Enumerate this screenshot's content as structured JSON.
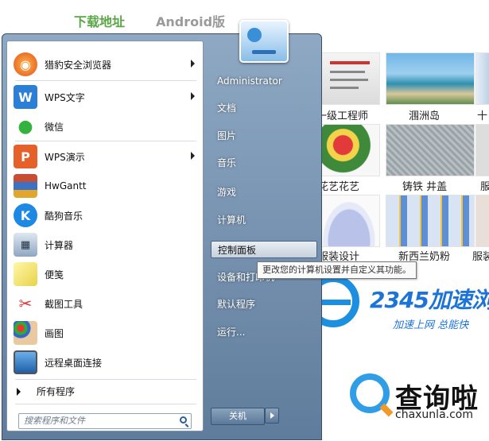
{
  "background": {
    "tabs": [
      "下载地址",
      "Android版"
    ],
    "captions": [
      "一级工程师",
      "涠洲岛",
      "十",
      "花艺花艺",
      "铸铁 井盖",
      "服",
      "服装设计",
      "新西兰奶粉",
      "服装"
    ],
    "brand": {
      "name": "2345加速浏",
      "sub": "加速上网   总能快"
    },
    "watermark": {
      "title": "查询啦",
      "url": "chaxunla.com"
    }
  },
  "start_menu": {
    "programs": [
      {
        "label": "猎豹安全浏览器",
        "icon": "cheetah-browser-icon",
        "submenu": true
      },
      {
        "label": "WPS文字",
        "icon": "wps-writer-icon",
        "submenu": true
      },
      {
        "label": "微信",
        "icon": "wechat-icon",
        "submenu": false
      },
      {
        "label": "WPS演示",
        "icon": "wps-presentation-icon",
        "submenu": true
      },
      {
        "label": "HwGantt",
        "icon": "hwgantt-icon",
        "submenu": false
      },
      {
        "label": "酷狗音乐",
        "icon": "kugou-music-icon",
        "submenu": false
      },
      {
        "label": "计算器",
        "icon": "calculator-icon",
        "submenu": false
      },
      {
        "label": "便笺",
        "icon": "sticky-notes-icon",
        "submenu": false
      },
      {
        "label": "截图工具",
        "icon": "snipping-tool-icon",
        "submenu": false
      },
      {
        "label": "画图",
        "icon": "paint-icon",
        "submenu": false
      },
      {
        "label": "远程桌面连接",
        "icon": "remote-desktop-icon",
        "submenu": false
      }
    ],
    "all_programs": "所有程序",
    "search_placeholder": "搜索程序和文件",
    "user": "Administrator",
    "places": [
      "文档",
      "图片",
      "音乐",
      "游戏",
      "计算机",
      "控制面板",
      "设备和打印机",
      "默认程序",
      "运行..."
    ],
    "shutdown": "关机",
    "tooltip": "更改您的计算机设置并自定义其功能。"
  }
}
